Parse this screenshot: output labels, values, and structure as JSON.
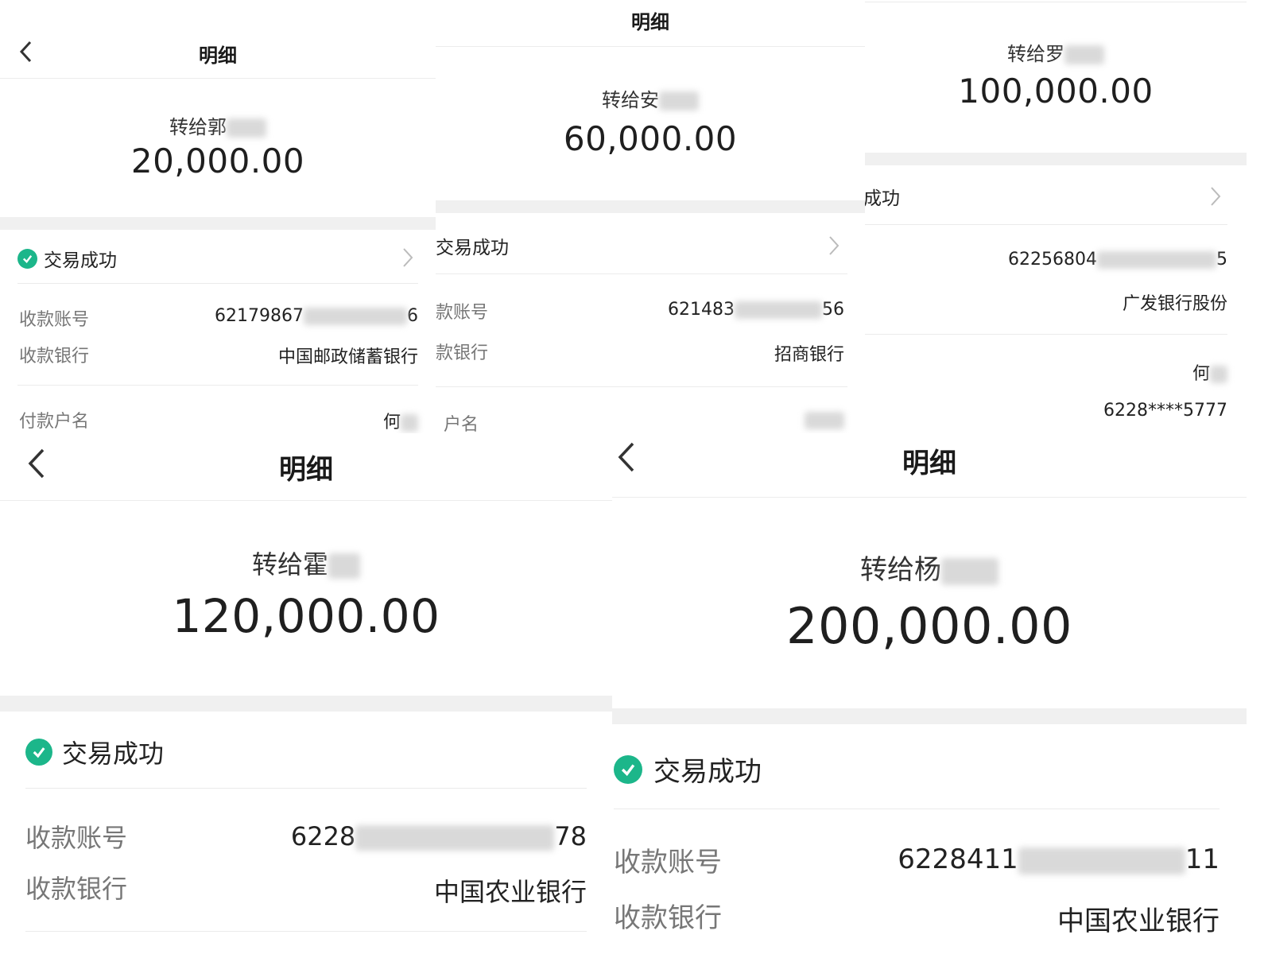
{
  "header": {
    "title": "明细"
  },
  "labels": {
    "account": "收款账号",
    "bank": "收款银行",
    "payer": "付款户名",
    "acc_trunc": "款账号",
    "bank_trunc": "款银行",
    "payer_trunc": "户名"
  },
  "status_text": "交易成功",
  "status_trunc": "成功",
  "panels": [
    {
      "recipient": "转给郭",
      "amount": "20,000.00",
      "account_prefix": "62179867",
      "account_suffix": "6",
      "bank": "中国邮政储蓄银行",
      "payer": "何"
    },
    {
      "recipient": "转给安",
      "amount": "60,000.00",
      "account_prefix": "621483",
      "account_suffix": "56",
      "bank": "招商银行"
    },
    {
      "recipient": "转给罗",
      "amount": "100,000.00",
      "account_prefix": "62256804",
      "account_suffix": "5",
      "bank": "广发银行股份",
      "payer": "何",
      "payer_account": "6228****5777"
    },
    {
      "recipient": "转给霍",
      "amount": "120,000.00",
      "account_prefix": "6228",
      "account_suffix": "78",
      "bank": "中国农业银行"
    },
    {
      "recipient": "转给杨",
      "amount": "200,000.00",
      "account_prefix": "6228411",
      "account_suffix": "11",
      "bank": "中国农业银行"
    }
  ],
  "icons": {
    "back": "chevron-left-icon",
    "check": "check-circle-icon",
    "arrow": "chevron-right-icon"
  },
  "colors": {
    "success": "#1cb68a",
    "divider": "#f0f0f0"
  }
}
